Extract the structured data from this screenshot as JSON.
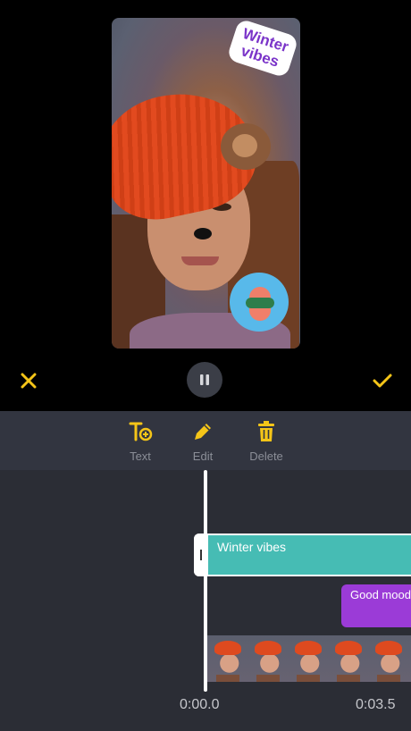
{
  "preview": {
    "sticker_text": "Winter vibes",
    "close_icon": "close-icon",
    "confirm_icon": "checkmark-icon",
    "pause_icon": "pause-icon"
  },
  "toolbar": {
    "text_label": "Text",
    "edit_label": "Edit",
    "delete_label": "Delete"
  },
  "timeline": {
    "clips": [
      {
        "label": "Winter vibes",
        "color": "#46bcb4"
      },
      {
        "label": "Good mood",
        "color": "#9b3bd7"
      }
    ],
    "time_start": "0:00.0",
    "time_marker": "0:03.5"
  },
  "colors": {
    "accent": "#f5c518",
    "panel": "#323540"
  }
}
